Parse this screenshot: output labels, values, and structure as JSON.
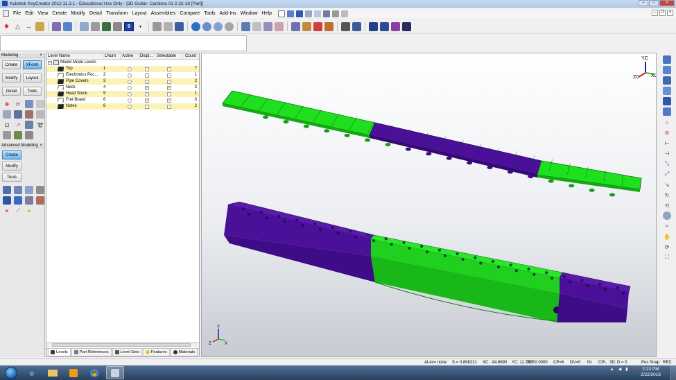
{
  "window": {
    "title": "Kubotek KeyCreator 2012 11.3.1 - Educational Use Only - [3D Guitar- Cardona 01 2-22-18 [Part]]"
  },
  "menu": {
    "items": [
      "File",
      "Edit",
      "View",
      "Create",
      "Modify",
      "Detail",
      "Transform",
      "Layout",
      "Assemblies",
      "Compare",
      "Tools",
      "Add-Ins",
      "Window",
      "Help"
    ]
  },
  "toolbar": {
    "level_number": "9"
  },
  "palette": {
    "modeling_header": "Modeling",
    "buttons_top": [
      "Create",
      "XForm",
      "Modify",
      "Layout",
      "Detail",
      "Tools"
    ],
    "advanced_header": "Advanced Modeling",
    "advanced_buttons": [
      "Create",
      "Modify",
      "Tools"
    ]
  },
  "levels": {
    "columns": [
      "Level Name",
      "LNum",
      "Active",
      "Displ...",
      "Selectable",
      "Count"
    ],
    "root_label": "Model Mode Levels",
    "rows": [
      {
        "name": "Top",
        "num": "1",
        "count": "7",
        "display": false,
        "selectable": false,
        "highlight": true
      },
      {
        "name": "Electronics Poc...",
        "num": "2",
        "count": "1",
        "display": false,
        "selectable": false,
        "highlight": false
      },
      {
        "name": "Pipe Covers",
        "num": "3",
        "count": "2",
        "display": false,
        "selectable": false,
        "highlight": true
      },
      {
        "name": "Neck",
        "num": "4",
        "count": "3",
        "display": true,
        "selectable": true,
        "highlight": false
      },
      {
        "name": "Head Stock",
        "num": "5",
        "count": "1",
        "display": false,
        "selectable": false,
        "highlight": true
      },
      {
        "name": "Fret Board",
        "num": "6",
        "count": "3",
        "display": true,
        "selectable": true,
        "highlight": false
      },
      {
        "name": "Notes",
        "num": "8",
        "count": "2",
        "display": false,
        "selectable": false,
        "highlight": true
      }
    ],
    "tabs": [
      "Levels",
      "Part References",
      "Level Sets",
      "Features",
      "Materials"
    ]
  },
  "viewport": {
    "triad_top": {
      "y": "YC",
      "x": "XC",
      "z": "ZC"
    },
    "triad_bottom": {
      "y": "Y",
      "x": "X",
      "z": "Z"
    },
    "colors": {
      "green": "#1fe01f",
      "purple": "#4b109a",
      "dark_green": "#0f8f0f"
    }
  },
  "status": {
    "alev": "ALev= none",
    "scale": "S = 0.898221",
    "xc": "XC: -34.8690",
    "yc": "YC: 11.7905",
    "zc": "ZC: 0.0000",
    "cp": "CP=6",
    "dv": "DV=0",
    "in": "IN",
    "cpl": "CPL",
    "three_d": "3D: D = 0",
    "snap": "Pos Snap",
    "rec": "REC"
  },
  "taskbar": {
    "time": "2:23 PM",
    "date": "2/22/2018"
  }
}
